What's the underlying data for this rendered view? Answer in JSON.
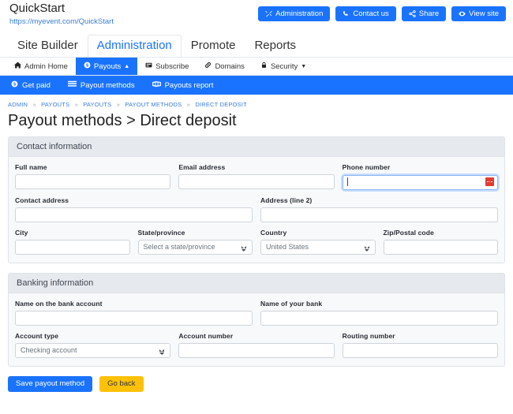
{
  "colors": {
    "accent": "#1a73ff",
    "link": "#3b7ddd",
    "warning": "#ffc107",
    "panel_header_bg": "#e6e9ed",
    "panel_body_bg": "#f8f9fb",
    "border": "#dfe3e8",
    "flag_red": "#e23b32"
  },
  "header": {
    "site_name": "QuickStart",
    "site_url": "https://myevent.com/QuickStart",
    "actions": [
      {
        "label": "Administration",
        "icon": "tools-icon"
      },
      {
        "label": "Contact us",
        "icon": "phone-icon"
      },
      {
        "label": "Share",
        "icon": "share-icon"
      },
      {
        "label": "View site",
        "icon": "eye-icon"
      }
    ]
  },
  "main_tabs": [
    {
      "label": "Site Builder",
      "active": false
    },
    {
      "label": "Administration",
      "active": true
    },
    {
      "label": "Promote",
      "active": false
    },
    {
      "label": "Reports",
      "active": false
    }
  ],
  "sub_nav": [
    {
      "label": "Admin Home",
      "icon": "home-icon",
      "active": false,
      "caret": ""
    },
    {
      "label": "Payouts",
      "icon": "dollar-circle-icon",
      "active": true,
      "caret": "▲"
    },
    {
      "label": "Subscribe",
      "icon": "card-icon",
      "active": false,
      "caret": ""
    },
    {
      "label": "Domains",
      "icon": "link-icon",
      "active": false,
      "caret": ""
    },
    {
      "label": "Security",
      "icon": "lock-icon",
      "active": false,
      "caret": "▼"
    }
  ],
  "blue_bar": [
    {
      "label": "Get paid",
      "icon": "dollar-circle-icon"
    },
    {
      "label": "Payout methods",
      "icon": "credit-card-icon"
    },
    {
      "label": "Payouts report",
      "icon": "report-icon"
    }
  ],
  "breadcrumb": {
    "items": [
      "ADMIN",
      "PAYOUTS",
      "PAYOUTS",
      "PAYOUT METHODS",
      "DIRECT DEPOSIT"
    ],
    "separator": "»"
  },
  "page_title": "Payout methods > Direct deposit",
  "contact_section": {
    "title": "Contact information",
    "full_name": {
      "label": "Full name",
      "value": "",
      "placeholder": ""
    },
    "email": {
      "label": "Email address",
      "value": "",
      "placeholder": ""
    },
    "phone": {
      "label": "Phone number",
      "value": "",
      "placeholder": "",
      "focused": true,
      "flag": "flag-icon"
    },
    "contact_address": {
      "label": "Contact address",
      "value": "",
      "placeholder": ""
    },
    "address_line2": {
      "label": "Address (line 2)",
      "value": "",
      "placeholder": ""
    },
    "city": {
      "label": "City",
      "value": "",
      "placeholder": ""
    },
    "state": {
      "label": "State/province",
      "selected": "Select a state/province"
    },
    "country": {
      "label": "Country",
      "selected": "United States"
    },
    "zip": {
      "label": "Zip/Postal code",
      "value": "",
      "placeholder": ""
    }
  },
  "banking_section": {
    "title": "Banking information",
    "account_name": {
      "label": "Name on the bank account",
      "value": "",
      "placeholder": ""
    },
    "bank_name": {
      "label": "Name of your bank",
      "value": "",
      "placeholder": ""
    },
    "account_type": {
      "label": "Account type",
      "selected": "Checking account"
    },
    "account_number": {
      "label": "Account number",
      "value": "",
      "placeholder": ""
    },
    "routing_number": {
      "label": "Routing number",
      "value": "",
      "placeholder": ""
    }
  },
  "footer": {
    "save_label": "Save payout method",
    "back_label": "Go back"
  }
}
